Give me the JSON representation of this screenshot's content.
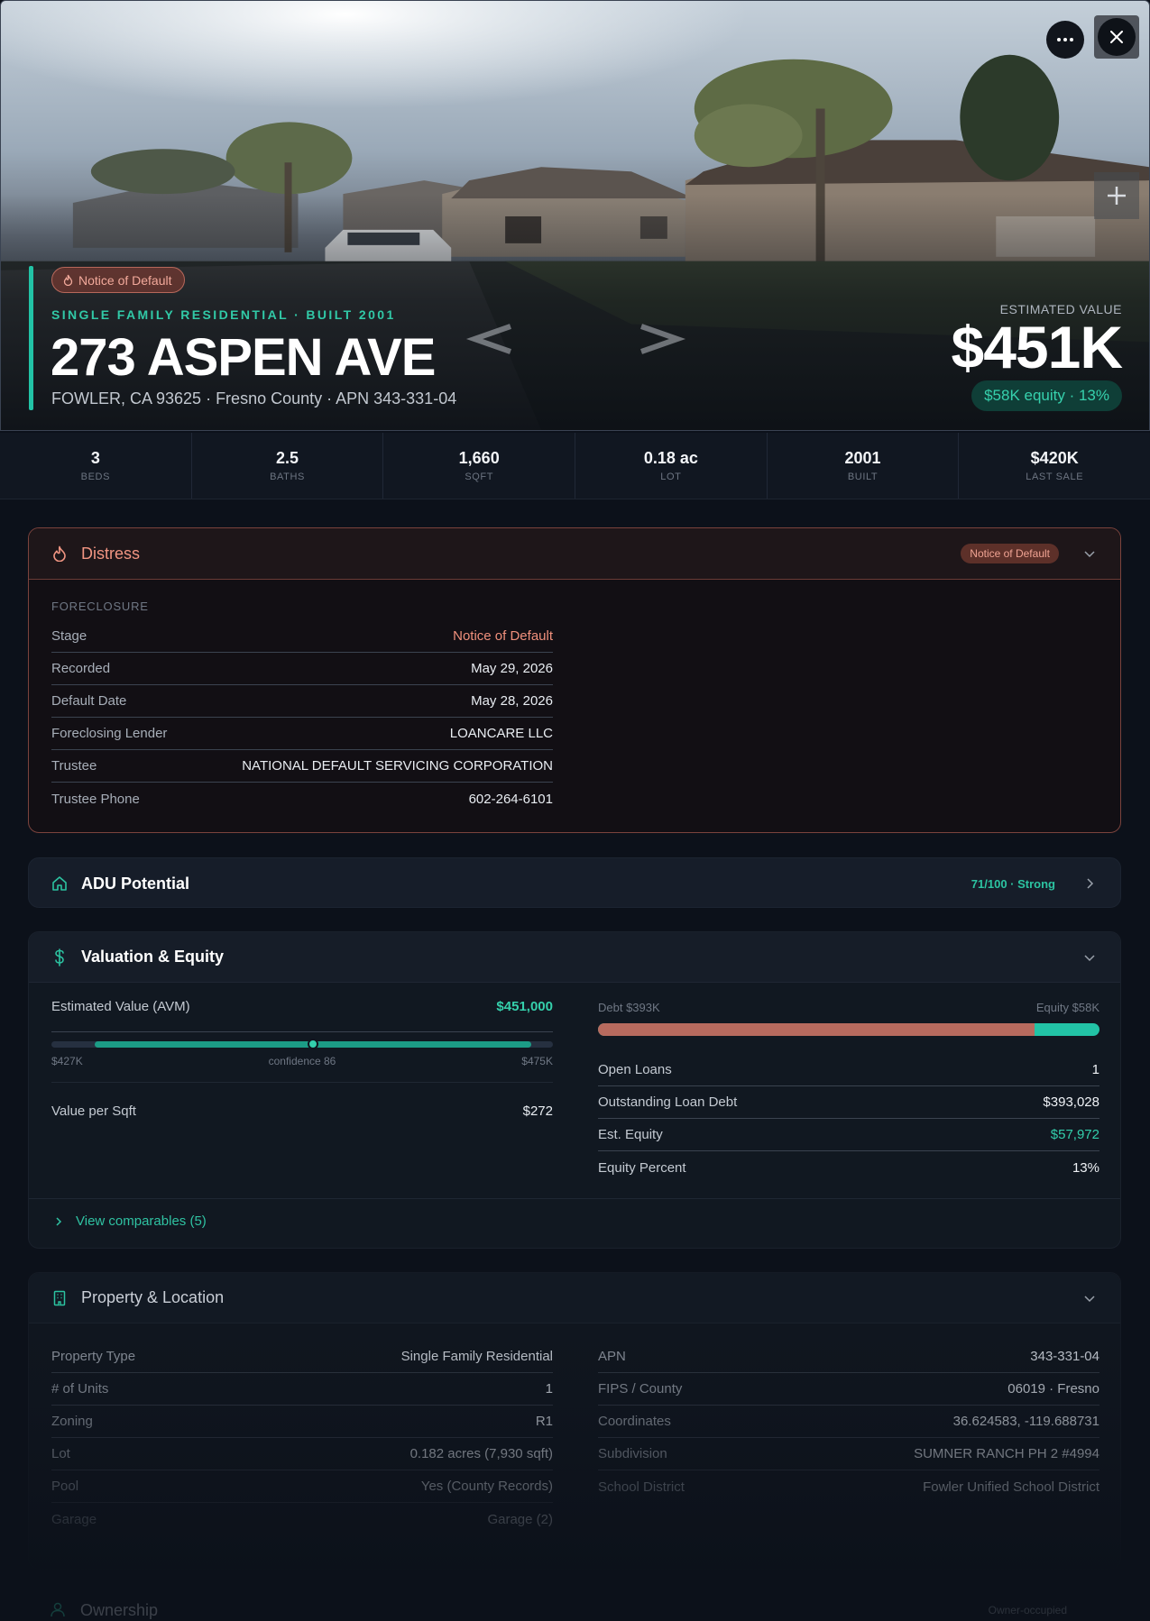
{
  "hero": {
    "status_pill": "Notice of Default",
    "kicker": "SINGLE FAMILY RESIDENTIAL · BUILT 2001",
    "address": "273 ASPEN AVE",
    "subline": "FOWLER, CA 93625 · Fresno County · APN 343-331-04",
    "est_label": "ESTIMATED VALUE",
    "est_value": "$451K",
    "equity_pill": "$58K equity · 13%"
  },
  "stats": [
    {
      "value": "3",
      "label": "BEDS"
    },
    {
      "value": "2.5",
      "label": "BATHS"
    },
    {
      "value": "1,660",
      "label": "SQFT"
    },
    {
      "value": "0.18 ac",
      "label": "LOT"
    },
    {
      "value": "2001",
      "label": "BUILT"
    },
    {
      "value": "$420K",
      "label": "LAST SALE"
    }
  ],
  "distress": {
    "title": "Distress",
    "badge": "Notice of Default",
    "section": "FORECLOSURE",
    "rows": [
      {
        "k": "Stage",
        "v": "Notice of Default"
      },
      {
        "k": "Recorded",
        "v": "May 29, 2026"
      },
      {
        "k": "Default Date",
        "v": "May 28, 2026"
      },
      {
        "k": "Foreclosing Lender",
        "v": "LOANCARE LLC"
      },
      {
        "k": "Trustee",
        "v": "NATIONAL DEFAULT SERVICING CORPORATION"
      },
      {
        "k": "Trustee Phone",
        "v": "602-264-6101"
      }
    ]
  },
  "adu": {
    "title": "ADU Potential",
    "score": "71/100 · Strong"
  },
  "valuation": {
    "title": "Valuation & Equity",
    "avm_label": "Estimated Value (AVM)",
    "avm_value": "$451,000",
    "range_low": "$427K",
    "range_high": "$475K",
    "confidence": "confidence 86",
    "avm_low_num": 427000,
    "avm_high_num": 475000,
    "avm_num": 451000,
    "vps_label": "Value per Sqft",
    "vps_value": "$272",
    "debt_label": "Debt $393K",
    "equity_label": "Equity $58K",
    "debt_fraction": 0.87,
    "rows": [
      {
        "k": "Open Loans",
        "v": "1"
      },
      {
        "k": "Outstanding Loan Debt",
        "v": "$393,028"
      },
      {
        "k": "Est. Equity",
        "v": "$57,972"
      },
      {
        "k": "Equity Percent",
        "v": "13%"
      }
    ],
    "comps_link": "View comparables (5)"
  },
  "property": {
    "title": "Property & Location",
    "left": [
      {
        "k": "Property Type",
        "v": "Single Family Residential"
      },
      {
        "k": "# of Units",
        "v": "1"
      },
      {
        "k": "Zoning",
        "v": "R1"
      },
      {
        "k": "Lot",
        "v": "0.182 acres (7,930 sqft)"
      },
      {
        "k": "Pool",
        "v": "Yes (County Records)"
      },
      {
        "k": "Garage",
        "v": "Garage (2)"
      }
    ],
    "right": [
      {
        "k": "APN",
        "v": "343-331-04"
      },
      {
        "k": "FIPS / County",
        "v": "06019 · Fresno"
      },
      {
        "k": "Coordinates",
        "v": "36.624583, -119.688731"
      },
      {
        "k": "Subdivision",
        "v": "SUMNER RANCH PH 2 #4994"
      },
      {
        "k": "School District",
        "v": "Fowler Unified School District"
      }
    ]
  },
  "ownership": {
    "title": "Ownership",
    "right": "Owner-occupied"
  },
  "colors": {
    "accent": "#22c3a6",
    "distress": "#f19582",
    "debt": "#b76a5e"
  }
}
